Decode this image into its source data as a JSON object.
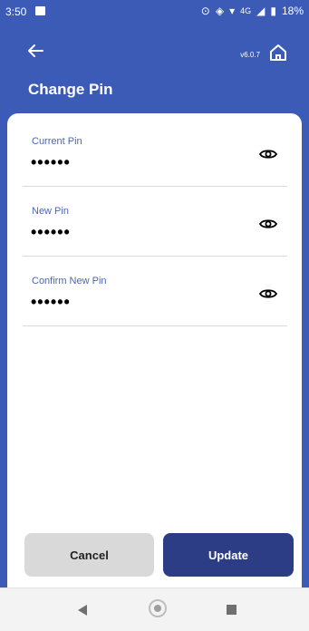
{
  "status_bar": {
    "time": "3:50",
    "network": "4G",
    "battery": "18%"
  },
  "header": {
    "version": "v6.0.7",
    "title": "Change Pin"
  },
  "form": {
    "fields": [
      {
        "label": "Current Pin",
        "value": "••••••"
      },
      {
        "label": "New Pin",
        "value": "••••••"
      },
      {
        "label": "Confirm New Pin",
        "value": "••••••"
      }
    ]
  },
  "actions": {
    "cancel_label": "Cancel",
    "update_label": "Update"
  },
  "colors": {
    "header_bg": "#3c5bb7",
    "update_button": "#2c3d86",
    "cancel_button": "#d9d9d9",
    "label_text": "#4a66b8"
  }
}
